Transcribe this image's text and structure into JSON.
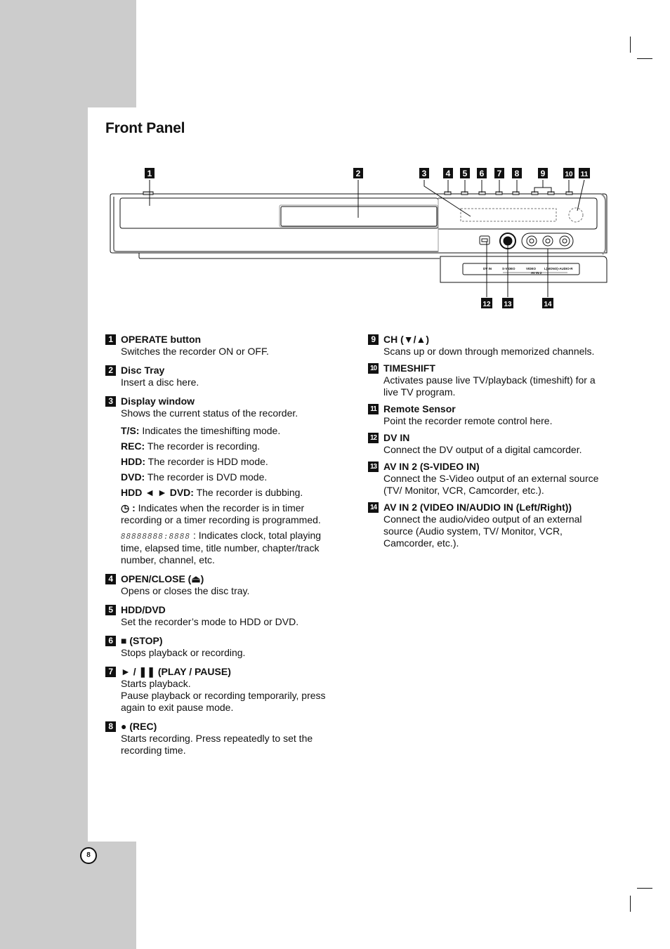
{
  "page": {
    "title": "Front Panel",
    "page_number": "8"
  },
  "diagram": {
    "callouts_top": [
      "1",
      "2",
      "3",
      "4",
      "5",
      "6",
      "7",
      "8",
      "9",
      "10",
      "11"
    ],
    "callouts_bottom": [
      "12",
      "13",
      "14"
    ],
    "jack_labels": {
      "dv_in": "DV IN",
      "s_video": "S-VIDEO",
      "video": "VIDEO",
      "audio": "L(MONO)-AUDIO-R",
      "av_in": "AV IN 2"
    }
  },
  "items": [
    {
      "num": "1",
      "title": "OPERATE button",
      "desc": "Switches the recorder ON or OFF."
    },
    {
      "num": "2",
      "title": "Disc Tray",
      "desc": "Insert a disc here."
    },
    {
      "num": "3",
      "title": "Display window",
      "desc": "Shows the current status of the recorder.",
      "sub": [
        {
          "key": "T/S:",
          "text": " Indicates the timeshifting mode."
        },
        {
          "key": "REC:",
          "text": " The recorder is recording."
        },
        {
          "key": "HDD:",
          "text": " The recorder is HDD mode."
        },
        {
          "key": "DVD:",
          "text": " The recorder is DVD mode."
        },
        {
          "key": "HDD ◄ ► DVD:",
          "text": " The recorder is dubbing."
        },
        {
          "key": "◷ :",
          "text": " Indicates when the recorder is in timer recording or a timer recording is programmed."
        },
        {
          "key": "88888888:8888",
          "key_style": "segment-display",
          "text": " : Indicates clock, total playing time, elapsed time, title number, chapter/track number, channel, etc."
        }
      ]
    },
    {
      "num": "4",
      "title": "OPEN/CLOSE (⏏)",
      "desc": "Opens or closes the disc tray."
    },
    {
      "num": "5",
      "title": "HDD/DVD",
      "desc": "Set the recorder’s mode to HDD or DVD."
    },
    {
      "num": "6",
      "title": "■ (STOP)",
      "desc": "Stops playback or recording."
    },
    {
      "num": "7",
      "title": "► / ❚❚ (PLAY / PAUSE)",
      "desc": "Starts playback.",
      "desc2": "Pause playback or recording temporarily, press again to exit pause mode."
    },
    {
      "num": "8",
      "title": "● (REC)",
      "desc": "Starts recording. Press repeatedly to set the recording time."
    },
    {
      "num": "9",
      "title": "CH (▼/▲)",
      "desc": "Scans up or down through memorized channels."
    },
    {
      "num": "10",
      "title": "TIMESHIFT",
      "desc": "Activates pause live TV/playback (timeshift) for a live TV program."
    },
    {
      "num": "11",
      "title": "Remote Sensor",
      "desc": "Point the recorder remote control here."
    },
    {
      "num": "12",
      "title": "DV IN",
      "desc": "Connect the DV output of a digital camcorder."
    },
    {
      "num": "13",
      "title": "AV IN 2 (S-VIDEO IN)",
      "desc": "Connect the S-Video output of an external source (TV/ Monitor, VCR, Camcorder, etc.)."
    },
    {
      "num": "14",
      "title": "AV IN 2 (VIDEO IN/AUDIO IN (Left/Right))",
      "desc": "Connect the audio/video output of an external source (Audio system, TV/ Monitor, VCR, Camcorder, etc.)."
    }
  ]
}
